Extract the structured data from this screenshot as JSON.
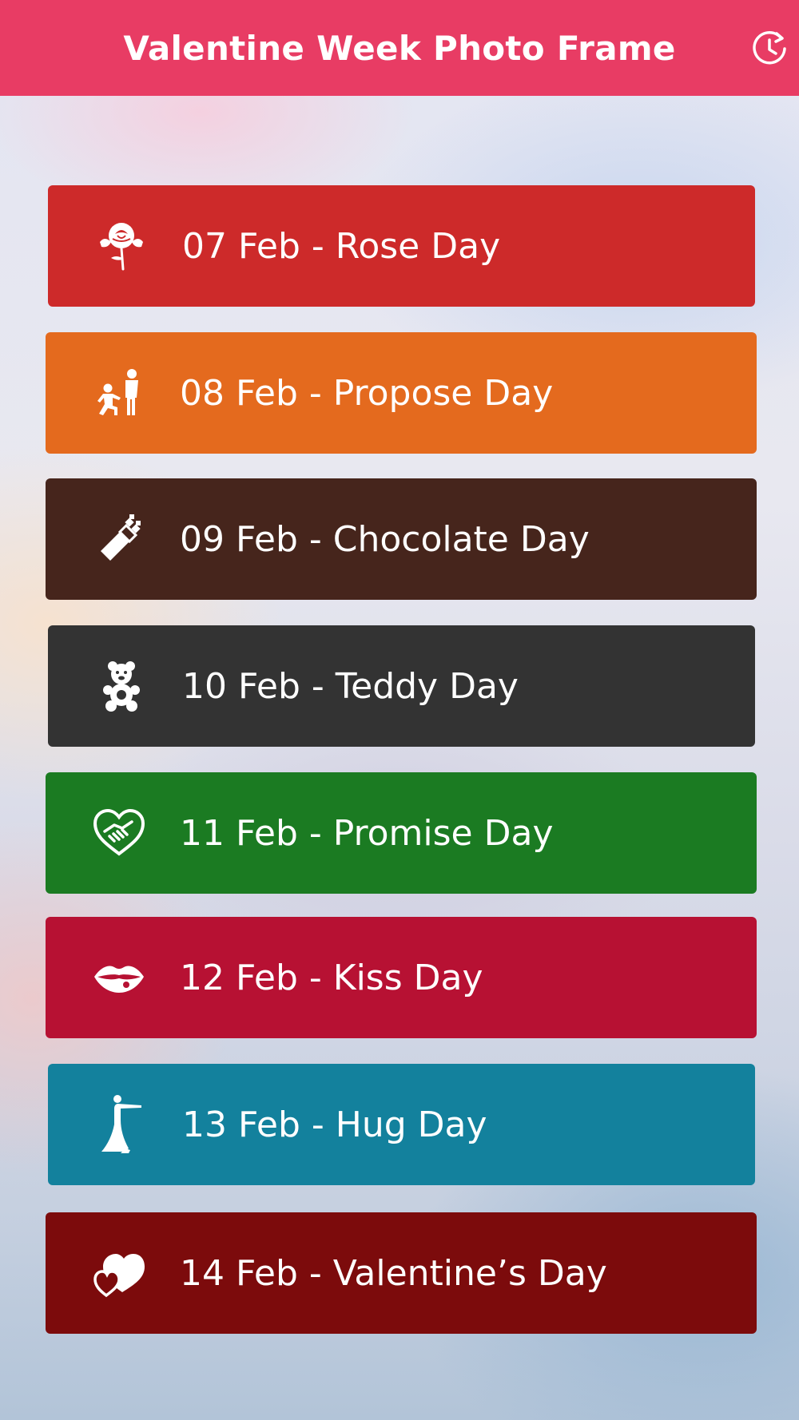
{
  "app_bar": {
    "title": "Valentine Week Photo Frame",
    "color": "#e83c64",
    "action_icon": "history-icon"
  },
  "days": [
    {
      "label": "07 Feb - Rose Day",
      "icon": "rose-icon",
      "color": "#cd2a2a"
    },
    {
      "label": "08 Feb - Propose Day",
      "icon": "propose-icon",
      "color": "#e46a1e"
    },
    {
      "label": "09 Feb - Chocolate Day",
      "icon": "chocolate-icon",
      "color": "#46251c"
    },
    {
      "label": "10 Feb - Teddy Day",
      "icon": "teddy-bear-icon",
      "color": "#333333"
    },
    {
      "label": "11 Feb - Promise Day",
      "icon": "handshake-heart-icon",
      "color": "#1b7b22"
    },
    {
      "label": "12 Feb - Kiss Day",
      "icon": "lips-icon",
      "color": "#b71133"
    },
    {
      "label": "13 Feb - Hug Day",
      "icon": "hug-icon",
      "color": "#13819d"
    },
    {
      "label": "14 Feb - Valentine’s Day",
      "icon": "hearts-icon",
      "color": "#7c0b0c"
    }
  ]
}
